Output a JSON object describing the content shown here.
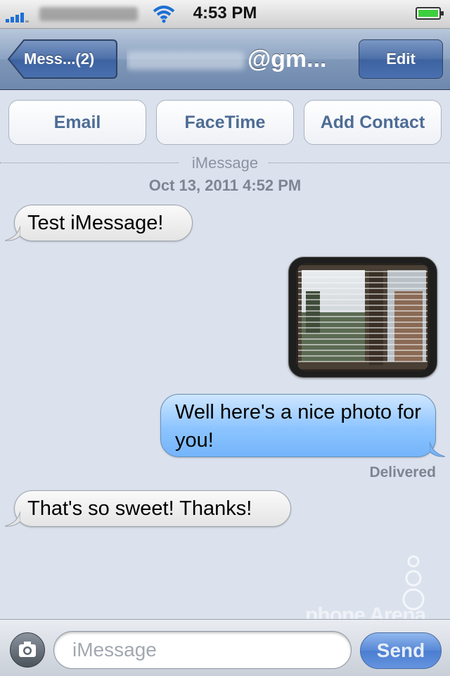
{
  "status_bar": {
    "time": "4:53 PM",
    "signal_icon": "signal-bars-icon",
    "wifi_icon": "wifi-icon",
    "battery_icon": "battery-icon"
  },
  "nav": {
    "back_label": "Mess...(2)",
    "title_suffix": "@gm...",
    "edit_label": "Edit"
  },
  "actions": {
    "email": "Email",
    "facetime": "FaceTime",
    "add_contact": "Add Contact"
  },
  "conversation": {
    "service_label": "iMessage",
    "timestamp": "Oct 13, 2011 4:52 PM",
    "messages": [
      {
        "from": "them",
        "text": "Test iMessage!"
      },
      {
        "from": "me",
        "type": "photo"
      },
      {
        "from": "me",
        "text": "Well here's a nice photo for you!"
      },
      {
        "from": "them",
        "text": "That's so sweet! Thanks!"
      }
    ],
    "delivered_label": "Delivered"
  },
  "compose": {
    "placeholder": "iMessage",
    "send_label": "Send",
    "camera_icon": "camera-icon"
  },
  "watermark": "phone Arena",
  "colors": {
    "sent_bubble": "#8cc4ff",
    "received_bubble": "#eeeeee",
    "background": "#dbe2ed",
    "navbar": "#7f97b8"
  }
}
